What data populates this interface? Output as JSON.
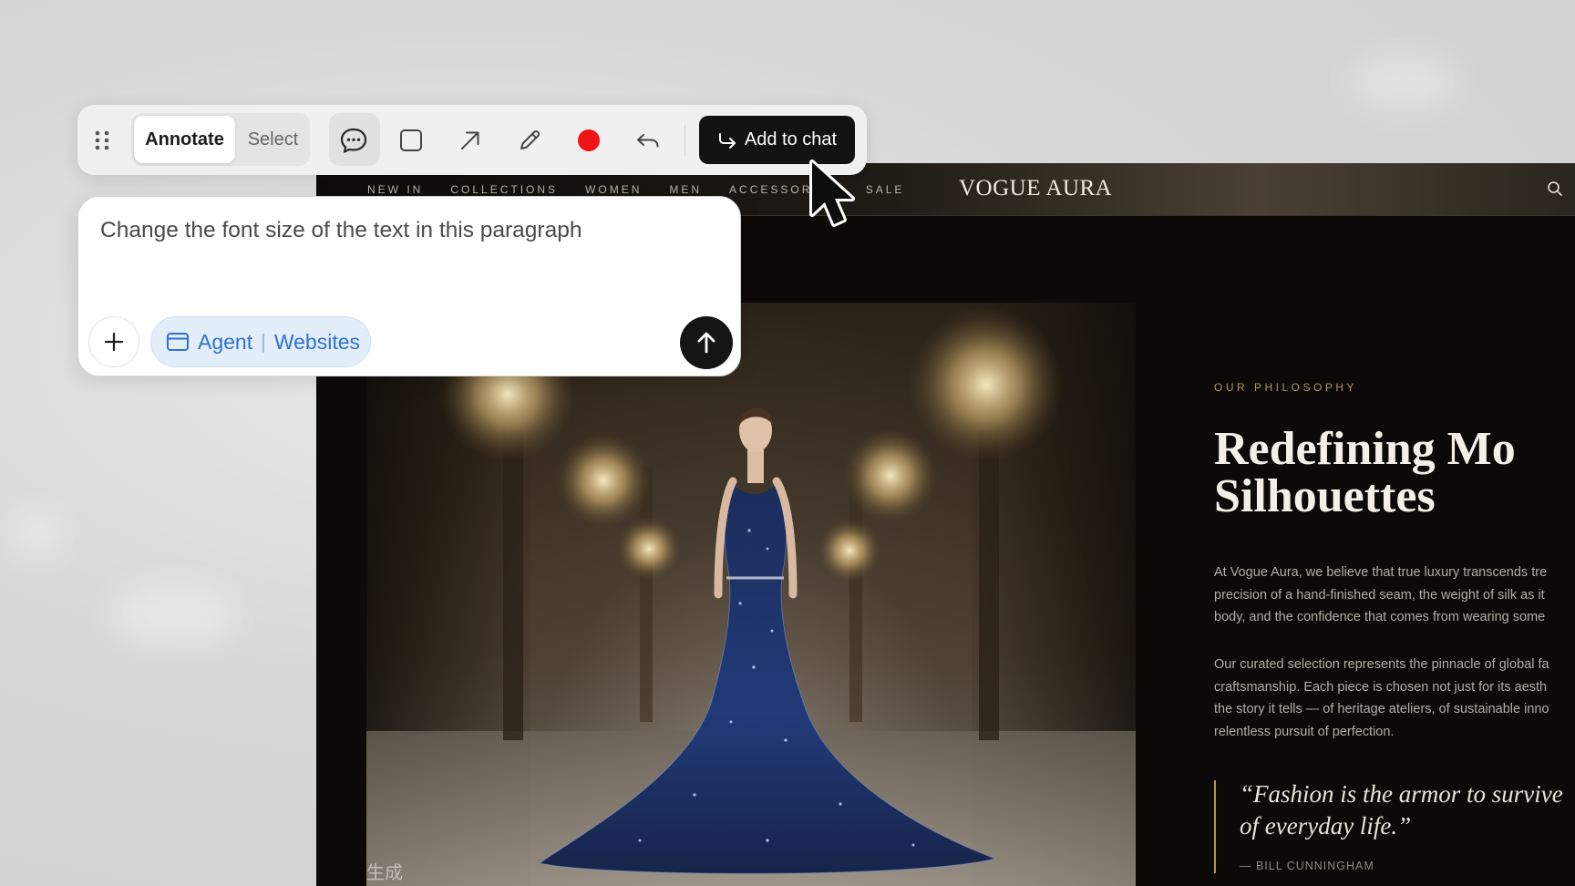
{
  "toolbar": {
    "annotate_label": "Annotate",
    "select_label": "Select",
    "add_to_chat_label": "Add to chat",
    "record_color": "#f01414",
    "tools": [
      "comment-icon",
      "rectangle-icon",
      "arrow-icon",
      "pencil-icon",
      "record-icon",
      "undo-icon"
    ]
  },
  "chat": {
    "prompt_text": "Change the font size of the text in this paragraph",
    "chip_left": "Agent",
    "chip_right": "Websites"
  },
  "site": {
    "brand": "VOGUE AURA",
    "nav": [
      "NEW IN",
      "COLLECTIONS",
      "WOMEN",
      "MEN",
      "ACCESSORIES",
      "SALE"
    ],
    "eyebrow": "OUR PHILOSOPHY",
    "headline_line1": "Redefining Mo",
    "headline_line2": "Silhouettes",
    "paragraph1_lines": [
      "At Vogue Aura, we believe that true luxury transcends tre",
      "precision of a hand-finished seam, the weight of silk as it",
      "body, and the confidence that comes from wearing some"
    ],
    "paragraph2_lines": [
      "Our curated selection represents the pinnacle of global fa",
      "craftsmanship. Each piece is chosen not just for its aesth",
      "the story it tells — of heritage ateliers, of sustainable inno",
      "relentless pursuit of perfection."
    ],
    "quote_line1": "“Fashion is the armor to survive",
    "quote_line2": "of everyday life.”",
    "quote_attribution": "— BILL CUNNINGHAM",
    "image_watermark": "生成",
    "accent_color": "#b89555"
  }
}
